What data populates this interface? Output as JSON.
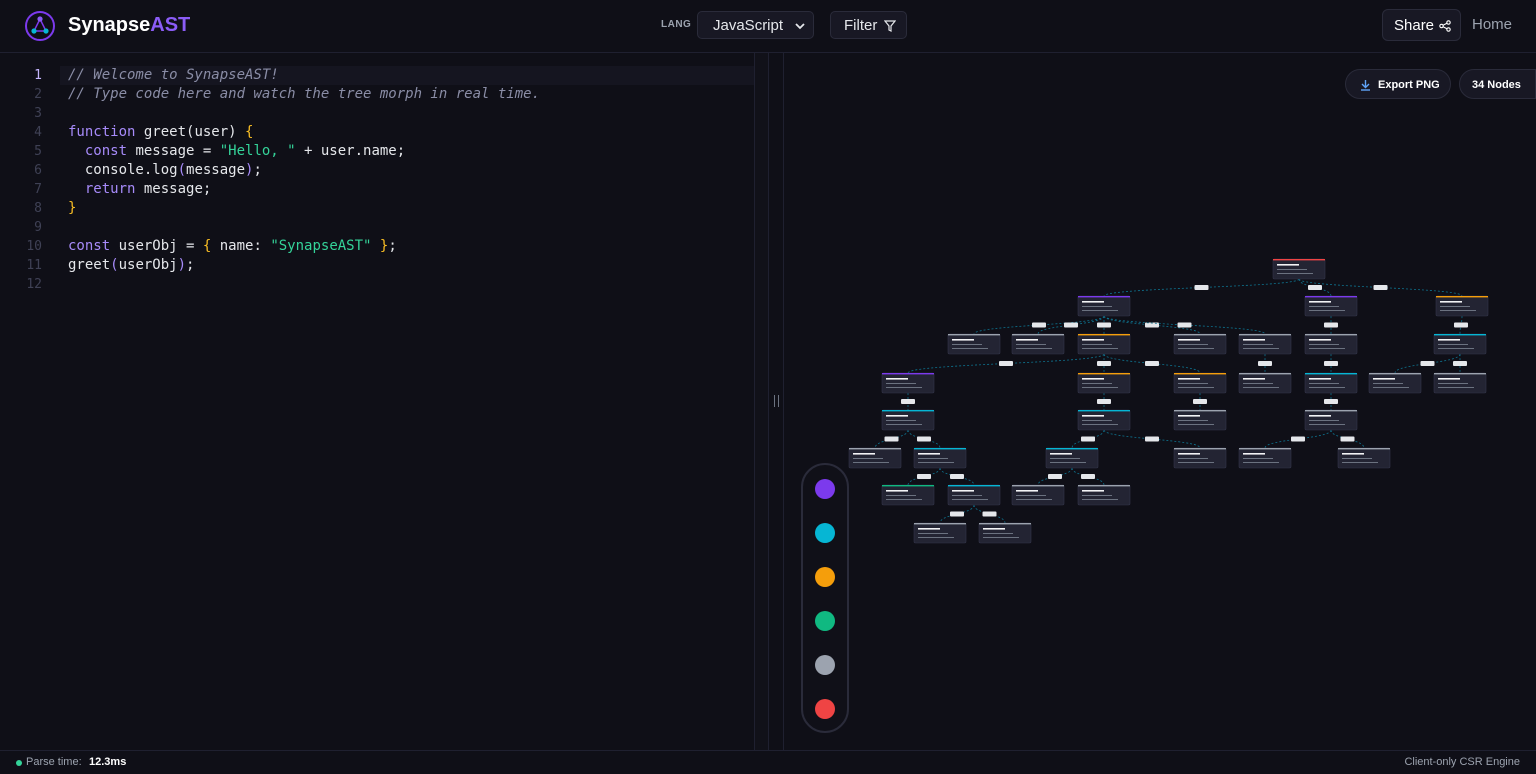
{
  "app": {
    "brand_main": "Synapse",
    "brand_accent": "AST"
  },
  "header": {
    "lang_label": "LANG",
    "language": "JavaScript",
    "filter_label": "Filter",
    "share_label": "Share",
    "home_label": "Home"
  },
  "editor": {
    "active_line": 1,
    "lines": [
      "1",
      "2",
      "3",
      "4",
      "5",
      "6",
      "7",
      "8",
      "9",
      "10",
      "11",
      "12"
    ],
    "code": {
      "l1": "// Welcome to SynapseAST!",
      "l2": "// Type code here and watch the tree morph in real time.",
      "l4_kw": "function",
      "l4_name": " greet(user) ",
      "l4_br": "{",
      "l5_kw": "const",
      "l5_a": " message = ",
      "l5_str": "\"Hello, \"",
      "l5_b": " + user.name;",
      "l6_a": "console.log",
      "l6_p1": "(",
      "l6_b": "message",
      "l6_p2": ")",
      "l6_c": ";",
      "l7_kw": "return",
      "l7_a": " message;",
      "l8_br": "}",
      "l10_kw": "const",
      "l10_a": " userObj = ",
      "l10_br1": "{",
      "l10_b": " name: ",
      "l10_str": "\"SynapseAST\"",
      "l10_br2": " }",
      "l10_c": ";",
      "l11_a": "greet",
      "l11_p1": "(",
      "l11_b": "userObj",
      "l11_p2": ")",
      "l11_c": ";"
    }
  },
  "canvas": {
    "export_label": "Export PNG",
    "node_count_label": "34 Nodes"
  },
  "palette": {
    "colors": [
      "#7c3aed",
      "#06b6d4",
      "#f59e0b",
      "#10b981",
      "#9ca3af",
      "#ef4444"
    ]
  },
  "status": {
    "parse_label": "Parse time:",
    "parse_value": "12.3ms",
    "engine_label": "Client-only CSR Engine"
  }
}
